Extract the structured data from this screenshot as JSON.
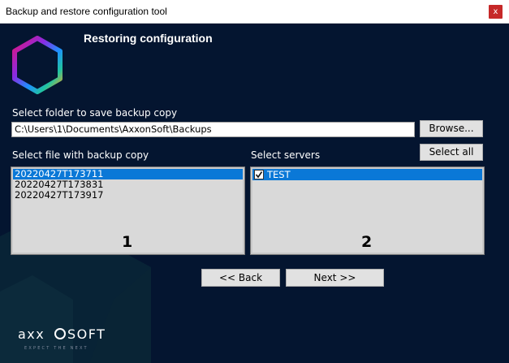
{
  "window": {
    "title": "Backup and restore configuration tool",
    "close_glyph": "x"
  },
  "header": {
    "title": "Restoring configuration"
  },
  "folder": {
    "label": "Select folder to save backup copy",
    "path": "C:\\Users\\1\\Documents\\AxxonSoft\\Backups",
    "browse_label": "Browse..."
  },
  "files": {
    "label": "Select file with backup copy",
    "items": [
      "20220427T173711",
      "20220427T173831",
      "20220427T173917"
    ],
    "selected_index": 0,
    "annotation": "1"
  },
  "servers": {
    "label": "Select servers",
    "select_all_label": "Select all",
    "items": [
      {
        "name": "TEST",
        "checked": true
      }
    ],
    "annotation": "2"
  },
  "nav": {
    "back_label": "<< Back",
    "next_label": "Next >>"
  },
  "brand": {
    "logo_text": "AXXONSOFT",
    "tagline": "EXPECT THE NEXT"
  },
  "colors": {
    "background": "#041530",
    "selection": "#0a78d7",
    "close": "#c62828"
  },
  "icons": {
    "logo": "hexagon-gradient-logo",
    "check": "checkmark-icon"
  }
}
